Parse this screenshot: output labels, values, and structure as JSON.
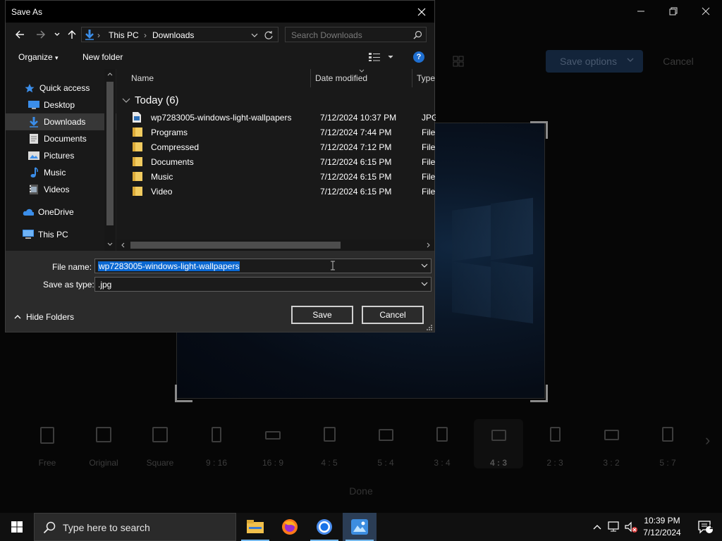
{
  "dialog": {
    "title": "Save As",
    "address": {
      "crumbs": [
        "This PC",
        "Downloads"
      ]
    },
    "search_placeholder": "Search Downloads",
    "toolbar": {
      "organize": "Organize",
      "new_folder": "New folder"
    },
    "nav": {
      "items": [
        {
          "label": "Quick access"
        },
        {
          "label": "Desktop"
        },
        {
          "label": "Downloads"
        },
        {
          "label": "Documents"
        },
        {
          "label": "Pictures"
        },
        {
          "label": "Music"
        },
        {
          "label": "Videos"
        },
        {
          "label": "OneDrive"
        },
        {
          "label": "This PC"
        }
      ]
    },
    "columns": {
      "name": "Name",
      "date": "Date modified",
      "type": "Type"
    },
    "group_label": "Today (6)",
    "files": [
      {
        "name": "wp7283005-windows-light-wallpapers",
        "date": "7/12/2024 10:37 PM",
        "type": "JPG F"
      },
      {
        "name": "Programs",
        "date": "7/12/2024 7:44 PM",
        "type": "File fo"
      },
      {
        "name": "Compressed",
        "date": "7/12/2024 7:12 PM",
        "type": "File fo"
      },
      {
        "name": "Documents",
        "date": "7/12/2024 6:15 PM",
        "type": "File fo"
      },
      {
        "name": "Music",
        "date": "7/12/2024 6:15 PM",
        "type": "File fo"
      },
      {
        "name": "Video",
        "date": "7/12/2024 6:15 PM",
        "type": "File fo"
      }
    ],
    "file_name_label": "File name:",
    "file_name_value": "wp7283005-windows-light-wallpapers",
    "save_type_label": "Save as type:",
    "save_type_value": ".jpg",
    "hide_folders": "Hide Folders",
    "save_button": "Save",
    "cancel_button": "Cancel",
    "accent_color": "#0a67d1"
  },
  "background_app": {
    "save_options": "Save options",
    "cancel": "Cancel",
    "aspect_ratios": [
      "Free",
      "Original",
      "Square",
      "9 : 16",
      "16 : 9",
      "4 : 5",
      "5 : 4",
      "3 : 4",
      "4 : 3",
      "2 : 3",
      "3 : 2",
      "5 : 7"
    ],
    "selected_aspect": "4 : 3",
    "done": "Done"
  },
  "taskbar": {
    "search_placeholder": "Type here to search",
    "apps": [
      "file-explorer-icon",
      "firefox-icon",
      "chrome-icon",
      "photos-icon"
    ],
    "time": "10:39 PM",
    "date": "7/12/2024",
    "notification_count": "1"
  }
}
